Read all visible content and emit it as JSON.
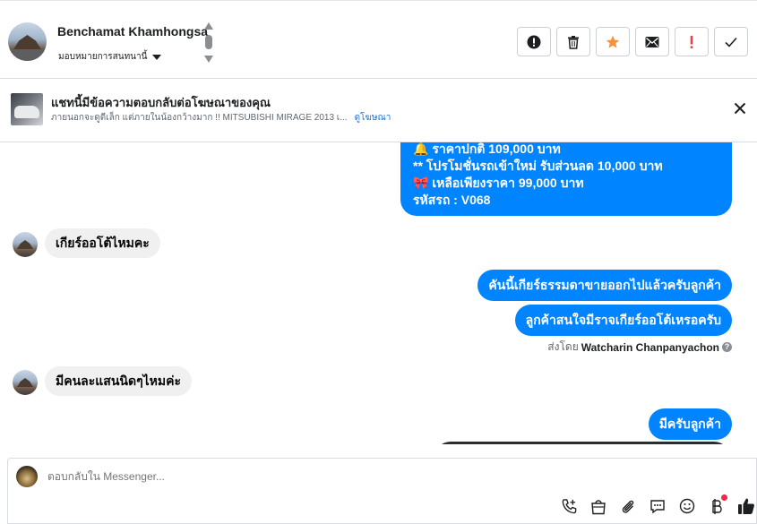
{
  "header": {
    "contact_name": "Benchamat Khamhongsa",
    "assign_label": "มอบหมายการสนทนานี้",
    "actions": [
      {
        "name": "report-button",
        "icon": "alert-circle-icon"
      },
      {
        "name": "delete-button",
        "icon": "trash-icon"
      },
      {
        "name": "star-button",
        "icon": "star-icon"
      },
      {
        "name": "mark-unread-button",
        "icon": "envelope-icon"
      },
      {
        "name": "follow-up-button",
        "icon": "exclamation-icon"
      },
      {
        "name": "mark-done-button",
        "icon": "check-icon"
      }
    ],
    "star_color": "#f7923b",
    "alert_color": "#e4424d"
  },
  "banner": {
    "title": "แชทนี้มีข้อความตอบกลับต่อโฆษณาของคุณ",
    "subtitle": "ภายนอกจะดูดีเล็ก แต่ภายในน้องกว้างมาก !! MITSUBISHI MIRAGE 2013 เ...",
    "link": "ดูโฆษณา"
  },
  "messages": {
    "ad_reply": {
      "lines": [
        "🔔 ราคาปกติ 109,000 บาท",
        "** โปรโมชั่นรถเข้าใหม่ รับส่วนลด 10,000 บาท",
        "🎀  เหลือเพียงราคา 99,000 บาท",
        "  รหัสรถ : V068"
      ]
    },
    "in_1": "เกียร์ออโต้ไหมคะ",
    "out_1": "คันนี้เกียร์ธรรมดาขายออกไปแล้วครับลูกค้า",
    "out_2": "ลูกค้าสนใจมีราจเกียร์ออโต้เหรอครับ",
    "sent_by_prefix": "ส่งโดย",
    "sent_by_name": "Watcharin Chanpanyachon",
    "help_glyph": "?",
    "in_2": "มีคนละแสนนิดๆไหมค่ะ",
    "out_3": "มีครับลูกค้า"
  },
  "composer": {
    "placeholder": "ตอบกลับใน Messenger..."
  },
  "colors": {
    "brand_blue": "#0084ff",
    "link_blue": "#216fdb"
  }
}
